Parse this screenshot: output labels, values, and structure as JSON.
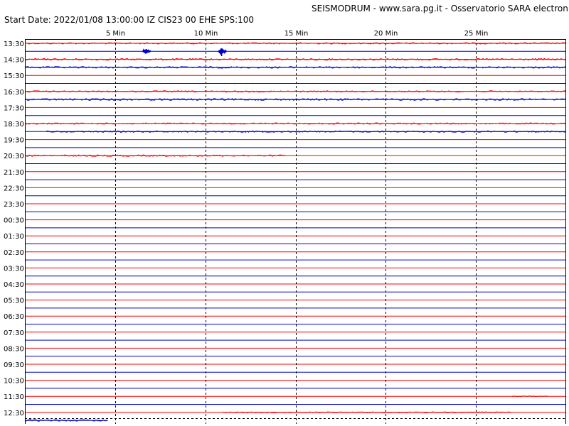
{
  "header": {
    "title": "SEISMODRUM - www.sara.pg.it - Osservatorio SARA electronic",
    "start_info": "Start Date: 2022/01/08 13:00:00 IZ CIS23 00 EHE  SPS:100"
  },
  "chart_data": {
    "type": "line",
    "minute_labels": [
      "5 Min",
      "10 Min",
      "15 Min",
      "20 Min",
      "25 Min"
    ],
    "minute_values": [
      5,
      10,
      15,
      20,
      25
    ],
    "x_range_minutes": [
      0,
      30
    ],
    "hour_labels": [
      "13:30",
      "14:30",
      "15:30",
      "16:30",
      "17:30",
      "18:30",
      "19:30",
      "20:30",
      "21:30",
      "22:30",
      "23:30",
      "00:30",
      "01:30",
      "02:30",
      "03:30",
      "04:30",
      "05:30",
      "06:30",
      "07:30",
      "08:30",
      "09:30",
      "10:30",
      "11:30",
      "12:30"
    ],
    "trace_colors": [
      "#ff0000",
      "#0000cc"
    ],
    "grid_color": "#000000",
    "current_trace_minutes": 4.6,
    "noisy_traces": [
      {
        "row": 0,
        "minutes": [
          0,
          30
        ],
        "amp": 1.0
      },
      {
        "row": 2,
        "minutes": [
          0,
          30
        ],
        "amp": 1.2
      },
      {
        "row": 3,
        "minutes": [
          0,
          30
        ],
        "amp": 1.2
      },
      {
        "row": 6,
        "minutes": [
          0,
          30
        ],
        "amp": 1.0
      },
      {
        "row": 7,
        "minutes": [
          0,
          30
        ],
        "amp": 1.3
      },
      {
        "row": 10,
        "minutes": [
          0,
          30
        ],
        "amp": 1.0
      },
      {
        "row": 11,
        "minutes": [
          1.2,
          30
        ],
        "amp": 1.0
      },
      {
        "row": 14,
        "minutes": [
          0,
          14.5
        ],
        "amp": 1.1
      },
      {
        "row": 44,
        "minutes": [
          27,
          29
        ],
        "amp": 0.6
      },
      {
        "row": 46,
        "minutes": [
          11,
          27
        ],
        "amp": 0.8
      },
      {
        "row": 47,
        "minutes": [
          0,
          4.6
        ],
        "amp": 1.2
      }
    ],
    "events": [
      {
        "row": 1,
        "minute": 6.7,
        "amp": 5
      },
      {
        "row": 1,
        "minute": 10.9,
        "amp": 7
      }
    ]
  }
}
